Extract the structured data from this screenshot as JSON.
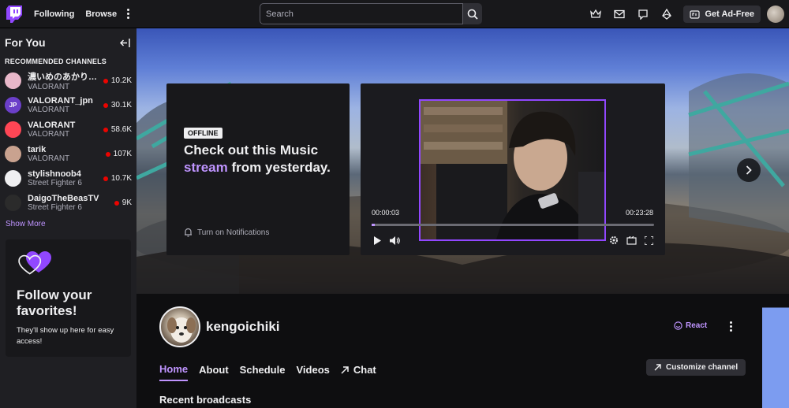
{
  "topbar": {
    "following": "Following",
    "browse": "Browse",
    "search_placeholder": "Search",
    "adfree": "Get Ad-Free",
    "icons": [
      "prime-crown-icon",
      "inbox-icon",
      "whispers-icon",
      "bits-icon",
      "ad-free-icon"
    ]
  },
  "sidebar": {
    "title": "For You",
    "section": "RECOMMENDED CHANNELS",
    "channels": [
      {
        "name": "濃いめのあかりん…",
        "game": "VALORANT",
        "viewers": "10.2K",
        "avatar_color": "#e8b7c9"
      },
      {
        "name": "VALORANT_jpn",
        "game": "VALORANT",
        "viewers": "30.1K",
        "avatar_color": "#6b3fc9",
        "initials": "JP"
      },
      {
        "name": "VALORANT",
        "game": "VALORANT",
        "viewers": "58.6K",
        "avatar_color": "#ff4655"
      },
      {
        "name": "tarik",
        "game": "VALORANT",
        "viewers": "107K",
        "avatar_color": "#c9a28f"
      },
      {
        "name": "stylishnoob4",
        "game": "Street Fighter 6",
        "viewers": "10.7K",
        "avatar_color": "#efeff1"
      },
      {
        "name": "DaigoTheBeasTV",
        "game": "Street Fighter 6",
        "viewers": "9K",
        "avatar_color": "#2b2b2b"
      }
    ],
    "show_more": "Show More",
    "follow_title": "Follow your favorites!",
    "follow_desc": "They'll show up here for easy access!"
  },
  "offline": {
    "badge": "OFFLINE",
    "line1": "Check out this Music",
    "accent": "stream",
    "line2": " from yesterday.",
    "notify": "Turn on Notifications"
  },
  "player": {
    "time_elapsed": "00:00:03",
    "time_total": "00:23:28",
    "progress_fraction": 0.002
  },
  "channel": {
    "username": "kengoichiki",
    "react": "React",
    "tabs": [
      "Home",
      "About",
      "Schedule",
      "Videos",
      "Chat"
    ],
    "customize": "Customize channel",
    "recent": "Recent broadcasts"
  },
  "colors": {
    "accent": "#bf94ff",
    "live": "#eb0400",
    "twitch_purple": "#9147ff"
  }
}
